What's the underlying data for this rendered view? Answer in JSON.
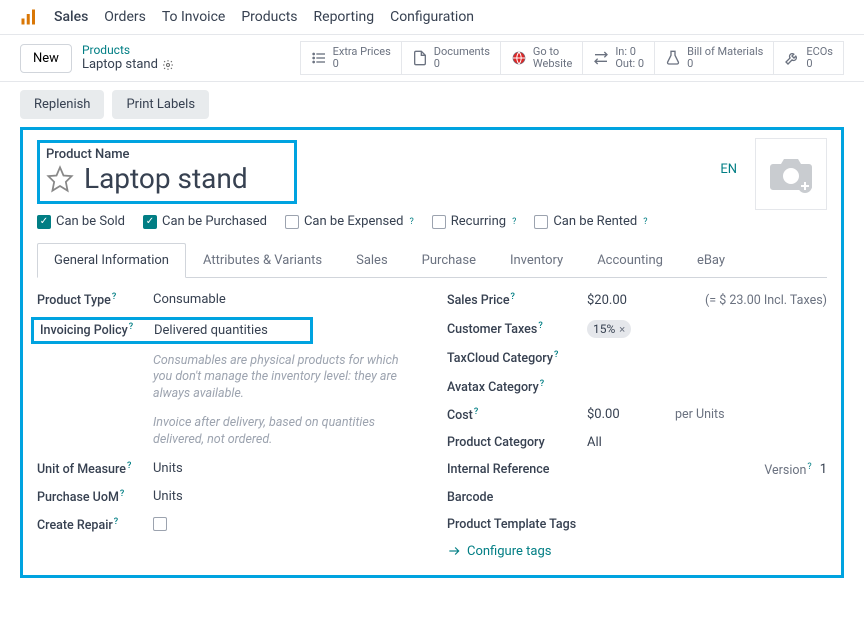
{
  "nav": {
    "items": [
      "Sales",
      "Orders",
      "To Invoice",
      "Products",
      "Reporting",
      "Configuration"
    ]
  },
  "sub": {
    "new_btn": "New",
    "crumb_parent": "Products",
    "crumb_current": "Laptop stand",
    "stats": {
      "extra_prices": {
        "label": "Extra Prices",
        "value": "0"
      },
      "documents": {
        "label": "Documents",
        "value": "0"
      },
      "goto_website": {
        "label": "Go to",
        "value": "Website"
      },
      "in_out": {
        "label": "In: 0",
        "value": "Out: 0"
      },
      "bom": {
        "label": "Bill of Materials",
        "value": "0"
      },
      "ecos": {
        "label": "ECOs",
        "value": "0"
      }
    }
  },
  "actions": {
    "replenish": "Replenish",
    "print_labels": "Print Labels"
  },
  "product": {
    "name_label": "Product Name",
    "name_value": "Laptop stand",
    "lang": "EN",
    "checks": {
      "can_sold": {
        "label": "Can be Sold",
        "checked": true
      },
      "can_purchased": {
        "label": "Can be Purchased",
        "checked": true
      },
      "can_expensed": {
        "label": "Can be Expensed",
        "checked": false
      },
      "recurring": {
        "label": "Recurring",
        "checked": false
      },
      "can_rented": {
        "label": "Can be Rented",
        "checked": false
      }
    }
  },
  "tabs": [
    "General Information",
    "Attributes & Variants",
    "Sales",
    "Purchase",
    "Inventory",
    "Accounting",
    "eBay"
  ],
  "left_fields": {
    "product_type": {
      "label": "Product Type",
      "value": "Consumable"
    },
    "invoicing_policy": {
      "label": "Invoicing Policy",
      "value": "Delivered quantities"
    },
    "note1": "Consumables are physical products for which you don't manage the inventory level: they are always available.",
    "note2": "Invoice after delivery, based on quantities delivered, not ordered.",
    "uom": {
      "label": "Unit of Measure",
      "value": "Units"
    },
    "purchase_uom": {
      "label": "Purchase UoM",
      "value": "Units"
    },
    "create_repair": {
      "label": "Create Repair"
    }
  },
  "right_fields": {
    "sales_price": {
      "label": "Sales Price",
      "value": "$20.00",
      "incl": "(= $ 23.00 Incl. Taxes)"
    },
    "customer_taxes": {
      "label": "Customer Taxes",
      "pill": "15%"
    },
    "taxcloud": {
      "label": "TaxCloud Category"
    },
    "avatax": {
      "label": "Avatax Category"
    },
    "cost": {
      "label": "Cost",
      "value": "$0.00",
      "extra": "per Units"
    },
    "product_cat": {
      "label": "Product Category",
      "value": "All"
    },
    "internal_ref": {
      "label": "Internal Reference",
      "version_label": "Version",
      "version_val": "1"
    },
    "barcode": {
      "label": "Barcode"
    },
    "template_tags": {
      "label": "Product Template Tags"
    },
    "configure_tags": "Configure tags"
  }
}
